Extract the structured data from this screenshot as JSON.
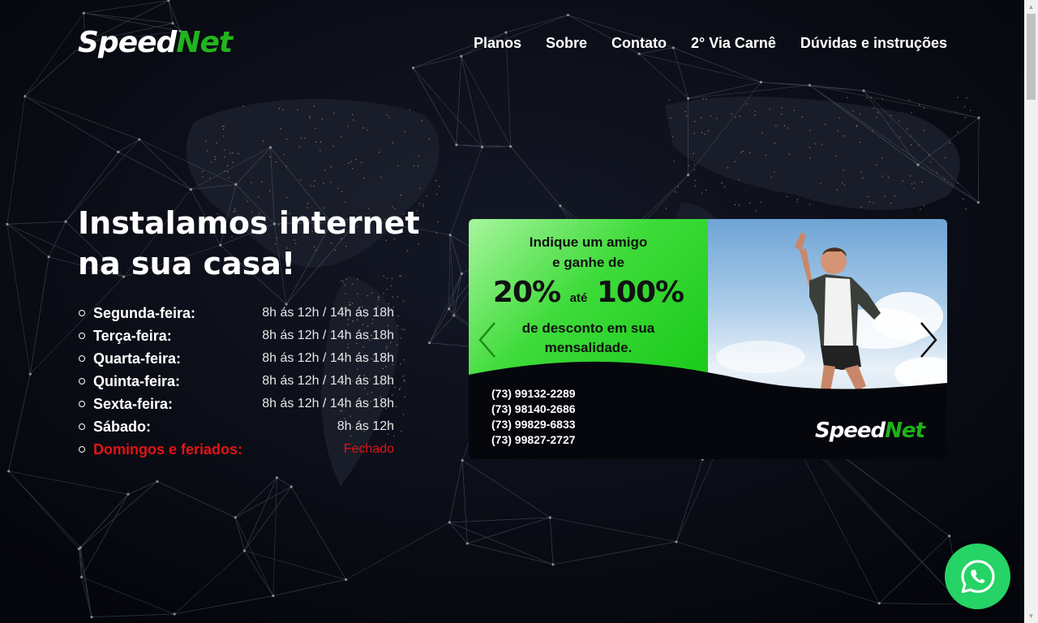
{
  "brand": {
    "part1": "Speed",
    "part2": "Net"
  },
  "nav": [
    {
      "label": "Planos"
    },
    {
      "label": "Sobre"
    },
    {
      "label": "Contato"
    },
    {
      "label": "2° Via Carnê"
    },
    {
      "label": "Dúvidas e instruções"
    }
  ],
  "hero": {
    "title": "Instalamos internet na sua casa!"
  },
  "hours": [
    {
      "day": "Segunda-feira:",
      "time": "8h ás 12h / 14h ás 18h"
    },
    {
      "day": "Terça-feira:",
      "time": "8h ás 12h / 14h ás 18h"
    },
    {
      "day": "Quarta-feira:",
      "time": "8h ás 12h / 14h ás 18h"
    },
    {
      "day": "Quinta-feira:",
      "time": "8h ás 12h / 14h ás 18h"
    },
    {
      "day": "Sexta-feira:",
      "time": "8h ás 12h / 14h ás 18h"
    },
    {
      "day": "Sábado:",
      "time": "8h ás 12h"
    },
    {
      "day": "Domingos e feriados:",
      "time": "Fechado"
    }
  ],
  "banner": {
    "line1": "Indique um amigo",
    "line2": "e ganhe de",
    "pct_from": "20%",
    "ate": "até",
    "pct_to": "100%",
    "line3": "de desconto em sua",
    "line4": "mensalidade.",
    "phones": [
      "(73) 99132-2289",
      "(73) 98140-2686",
      "(73) 99829-6833",
      "(73) 99827-2727"
    ],
    "logo_part1": "Speed",
    "logo_part2": "Net"
  },
  "icons": {
    "prev": "chevron-left-icon",
    "next": "chevron-right-icon",
    "whatsapp": "whatsapp-icon"
  },
  "colors": {
    "accent": "#22b41e",
    "closed": "#e21414",
    "whatsapp": "#25d366",
    "background": "#05060c"
  }
}
